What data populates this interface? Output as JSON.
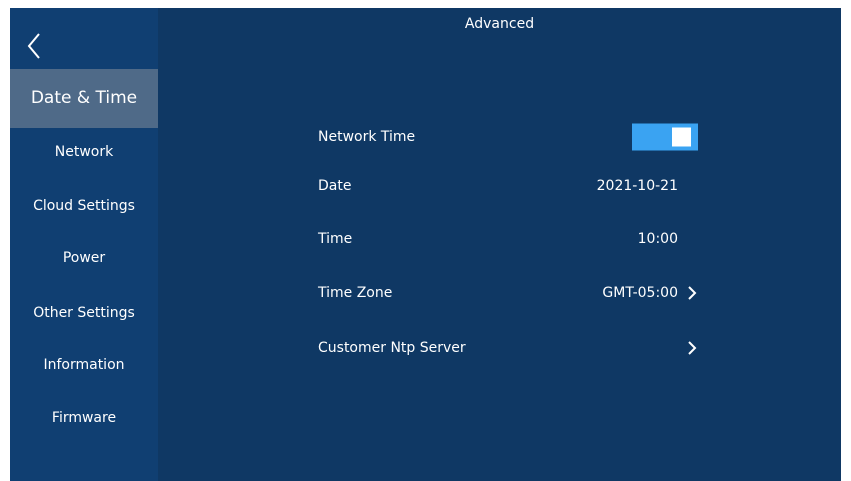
{
  "header": {
    "title": "Advanced"
  },
  "sidebar": {
    "items": [
      {
        "label": "Date & Time",
        "active": true
      },
      {
        "label": "Network",
        "active": false
      },
      {
        "label": "Cloud Settings",
        "active": false
      },
      {
        "label": "Power",
        "active": false
      },
      {
        "label": "Other Settings",
        "active": false
      },
      {
        "label": "Information",
        "active": false
      },
      {
        "label": "Firmware",
        "active": false
      }
    ]
  },
  "settings": {
    "network_time": {
      "label": "Network Time",
      "enabled": true
    },
    "date": {
      "label": "Date",
      "value": "2021-10-21"
    },
    "time": {
      "label": "Time",
      "value": "10:00"
    },
    "time_zone": {
      "label": "Time Zone",
      "value": "GMT-05:00"
    },
    "ntp_server": {
      "label": "Customer Ntp Server"
    }
  },
  "icons": {
    "back": "chevron-left-icon",
    "row_arrow": "chevron-right-icon"
  },
  "colors": {
    "background": "#0f3864",
    "sidebar": "#103f72",
    "active_item": "#4f6a88",
    "toggle_on": "#3aa3f2",
    "text": "#ffffff"
  }
}
